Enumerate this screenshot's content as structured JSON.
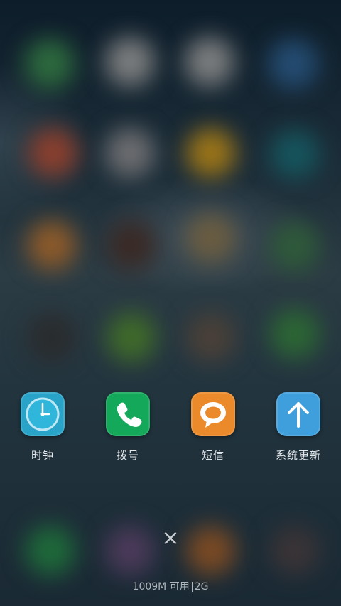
{
  "recent_apps": [
    {
      "label": "时钟",
      "icon": "clock-icon",
      "color": "#2aa3c8"
    },
    {
      "label": "拨号",
      "icon": "phone-icon",
      "color": "#14a85a"
    },
    {
      "label": "短信",
      "icon": "message-icon",
      "color": "#ea8a2b"
    },
    {
      "label": "系统更新",
      "icon": "update-arrow-icon",
      "color": "#3f9fdc"
    }
  ],
  "memory": {
    "available": "1009M 可用",
    "total": "2G"
  },
  "close_symbol": "×"
}
